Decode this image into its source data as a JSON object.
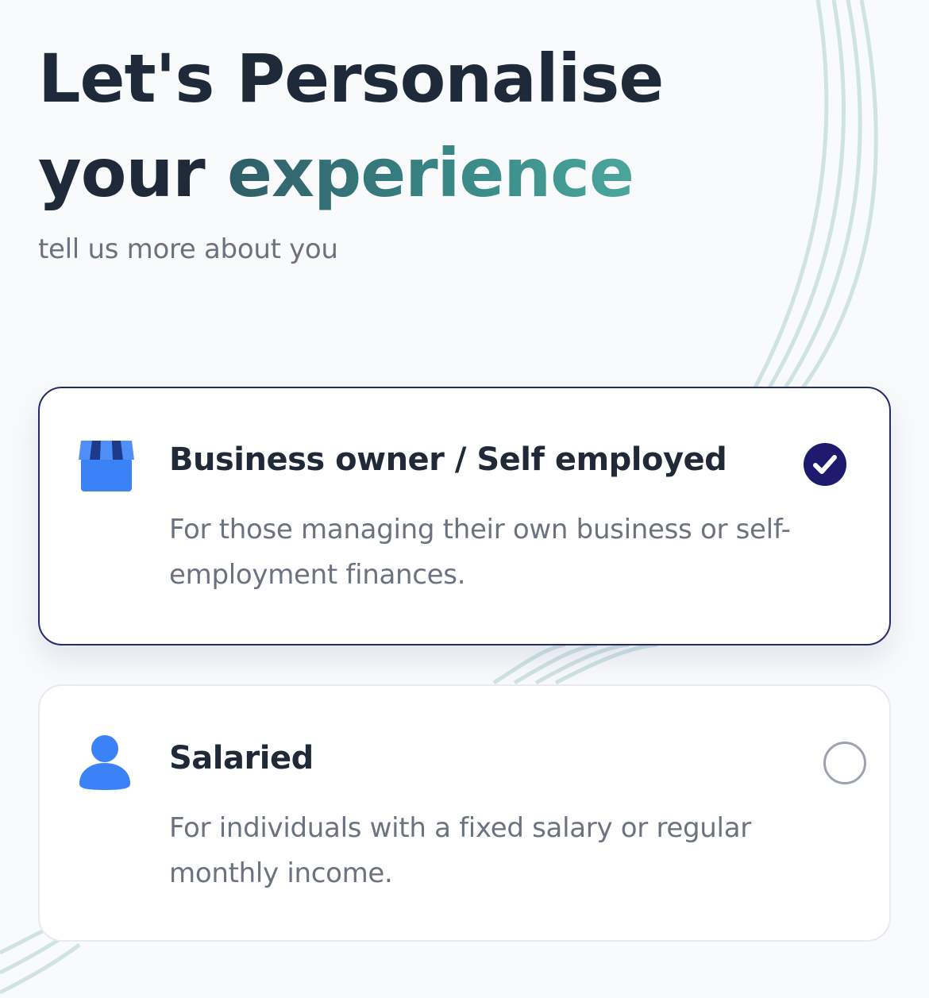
{
  "header": {
    "title_line1": "Let's Personalise",
    "title_line2_plain": "your ",
    "title_line2_accent": "experience",
    "subtitle": "tell us more about you"
  },
  "options": [
    {
      "title": "Business owner / Self employed",
      "description": "For those managing their own business or self-employment finances.",
      "icon": "storefront-icon",
      "selected": true
    },
    {
      "title": "Salaried",
      "description": "For individuals with a fixed salary or regular monthly income.",
      "icon": "person-icon",
      "selected": false
    }
  ],
  "colors": {
    "selected_border": "#272a6b",
    "accent_gradient_start": "#2f5d67",
    "accent_gradient_end": "#4aa79c",
    "icon_blue": "#3b82f6",
    "check_fill": "#1e1b6e"
  }
}
